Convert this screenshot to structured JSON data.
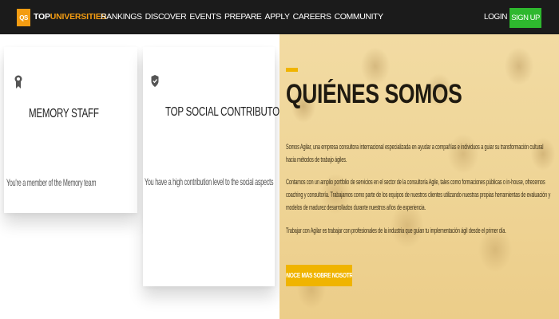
{
  "header": {
    "logo_mark": "QS",
    "logo_top": "TOP",
    "logo_uni": "UNIVERSITIES",
    "nav_items": [
      "RANKINGS",
      "DISCOVER",
      "EVENTS",
      "PREPARE",
      "APPLY",
      "CAREERS",
      "COMMUNITY"
    ],
    "login_label": "LOGIN",
    "signup_label": "SIGN UP",
    "colors": {
      "bar": "#1b1b1b",
      "accent": "#f39c12",
      "signup": "#2eb82e"
    }
  },
  "cards": [
    {
      "icon": "badge-icon",
      "title": "MEMORY STAFF",
      "text": "You're a member of the Memory team"
    },
    {
      "icon": "shield-check-icon",
      "title": "TOP SOCIAL CONTRIBUTOR",
      "text": "You have a high contribution level to the social aspects"
    }
  ],
  "hero": {
    "title": "QUIÉNES SOMOS",
    "paragraphs": [
      "Somos Agilar, una empresa consultora internacional especializada en ayudar a compañías e individuos a guiar su transformación cultural hacia métodos de trabajo ágiles.",
      "Contamos con un amplio portfolio de servicios en el sector de la consultoría Agile, tales como formaciones públicas o in-house, ofrecemos coaching y consultoría. Trabajamos como parte de los equipos de nuestros clientes utilizando nuestras propias herramientas de evaluación y modelos de madurez desarrollados durante nuestros años de experiencia.",
      "Trabajar con Agilar es trabajar con profesionales de la industria que guían tu implementación ágil desde el primer día."
    ],
    "button_label": "CONOCE MÁS SOBRE NOSOTROS",
    "accent_color": "#f0b400"
  }
}
